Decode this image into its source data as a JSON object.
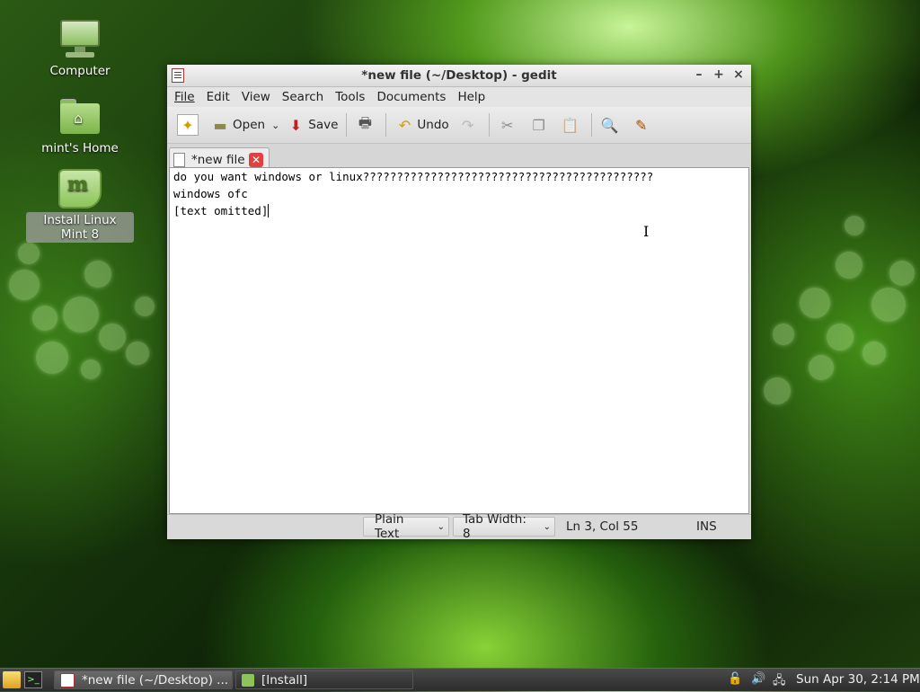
{
  "desktop": {
    "icons": [
      {
        "label": "Computer",
        "icon": "computer-icon"
      },
      {
        "label": "mint's Home",
        "icon": "home-folder-icon"
      },
      {
        "label": "Install Linux Mint 8",
        "icon": "mint-installer-icon",
        "selected": true
      }
    ]
  },
  "window": {
    "title": "*new file (~/Desktop) - gedit",
    "menu": [
      "File",
      "Edit",
      "View",
      "Search",
      "Tools",
      "Documents",
      "Help"
    ],
    "toolbar": {
      "open_label": "Open",
      "save_label": "Save",
      "undo_label": "Undo"
    },
    "tab": {
      "label": "*new file"
    },
    "editor": {
      "lines": [
        "do you want windows or linux???????????????????????????????????????????",
        "windows ofc",
        "[text omitted]"
      ]
    },
    "statusbar": {
      "language": "Plain Text",
      "tab_width": "Tab Width:  8",
      "position": "Ln 3, Col 55",
      "mode": "INS"
    }
  },
  "panel": {
    "tasks": [
      {
        "label": "*new file (~/Desktop) ...",
        "active": true
      },
      {
        "label": "[Install]",
        "active": false
      }
    ],
    "clock": "Sun Apr 30,  2:14 PM"
  },
  "colors": {
    "accent_green": "#7cb44a",
    "close_red": "#e04040"
  }
}
